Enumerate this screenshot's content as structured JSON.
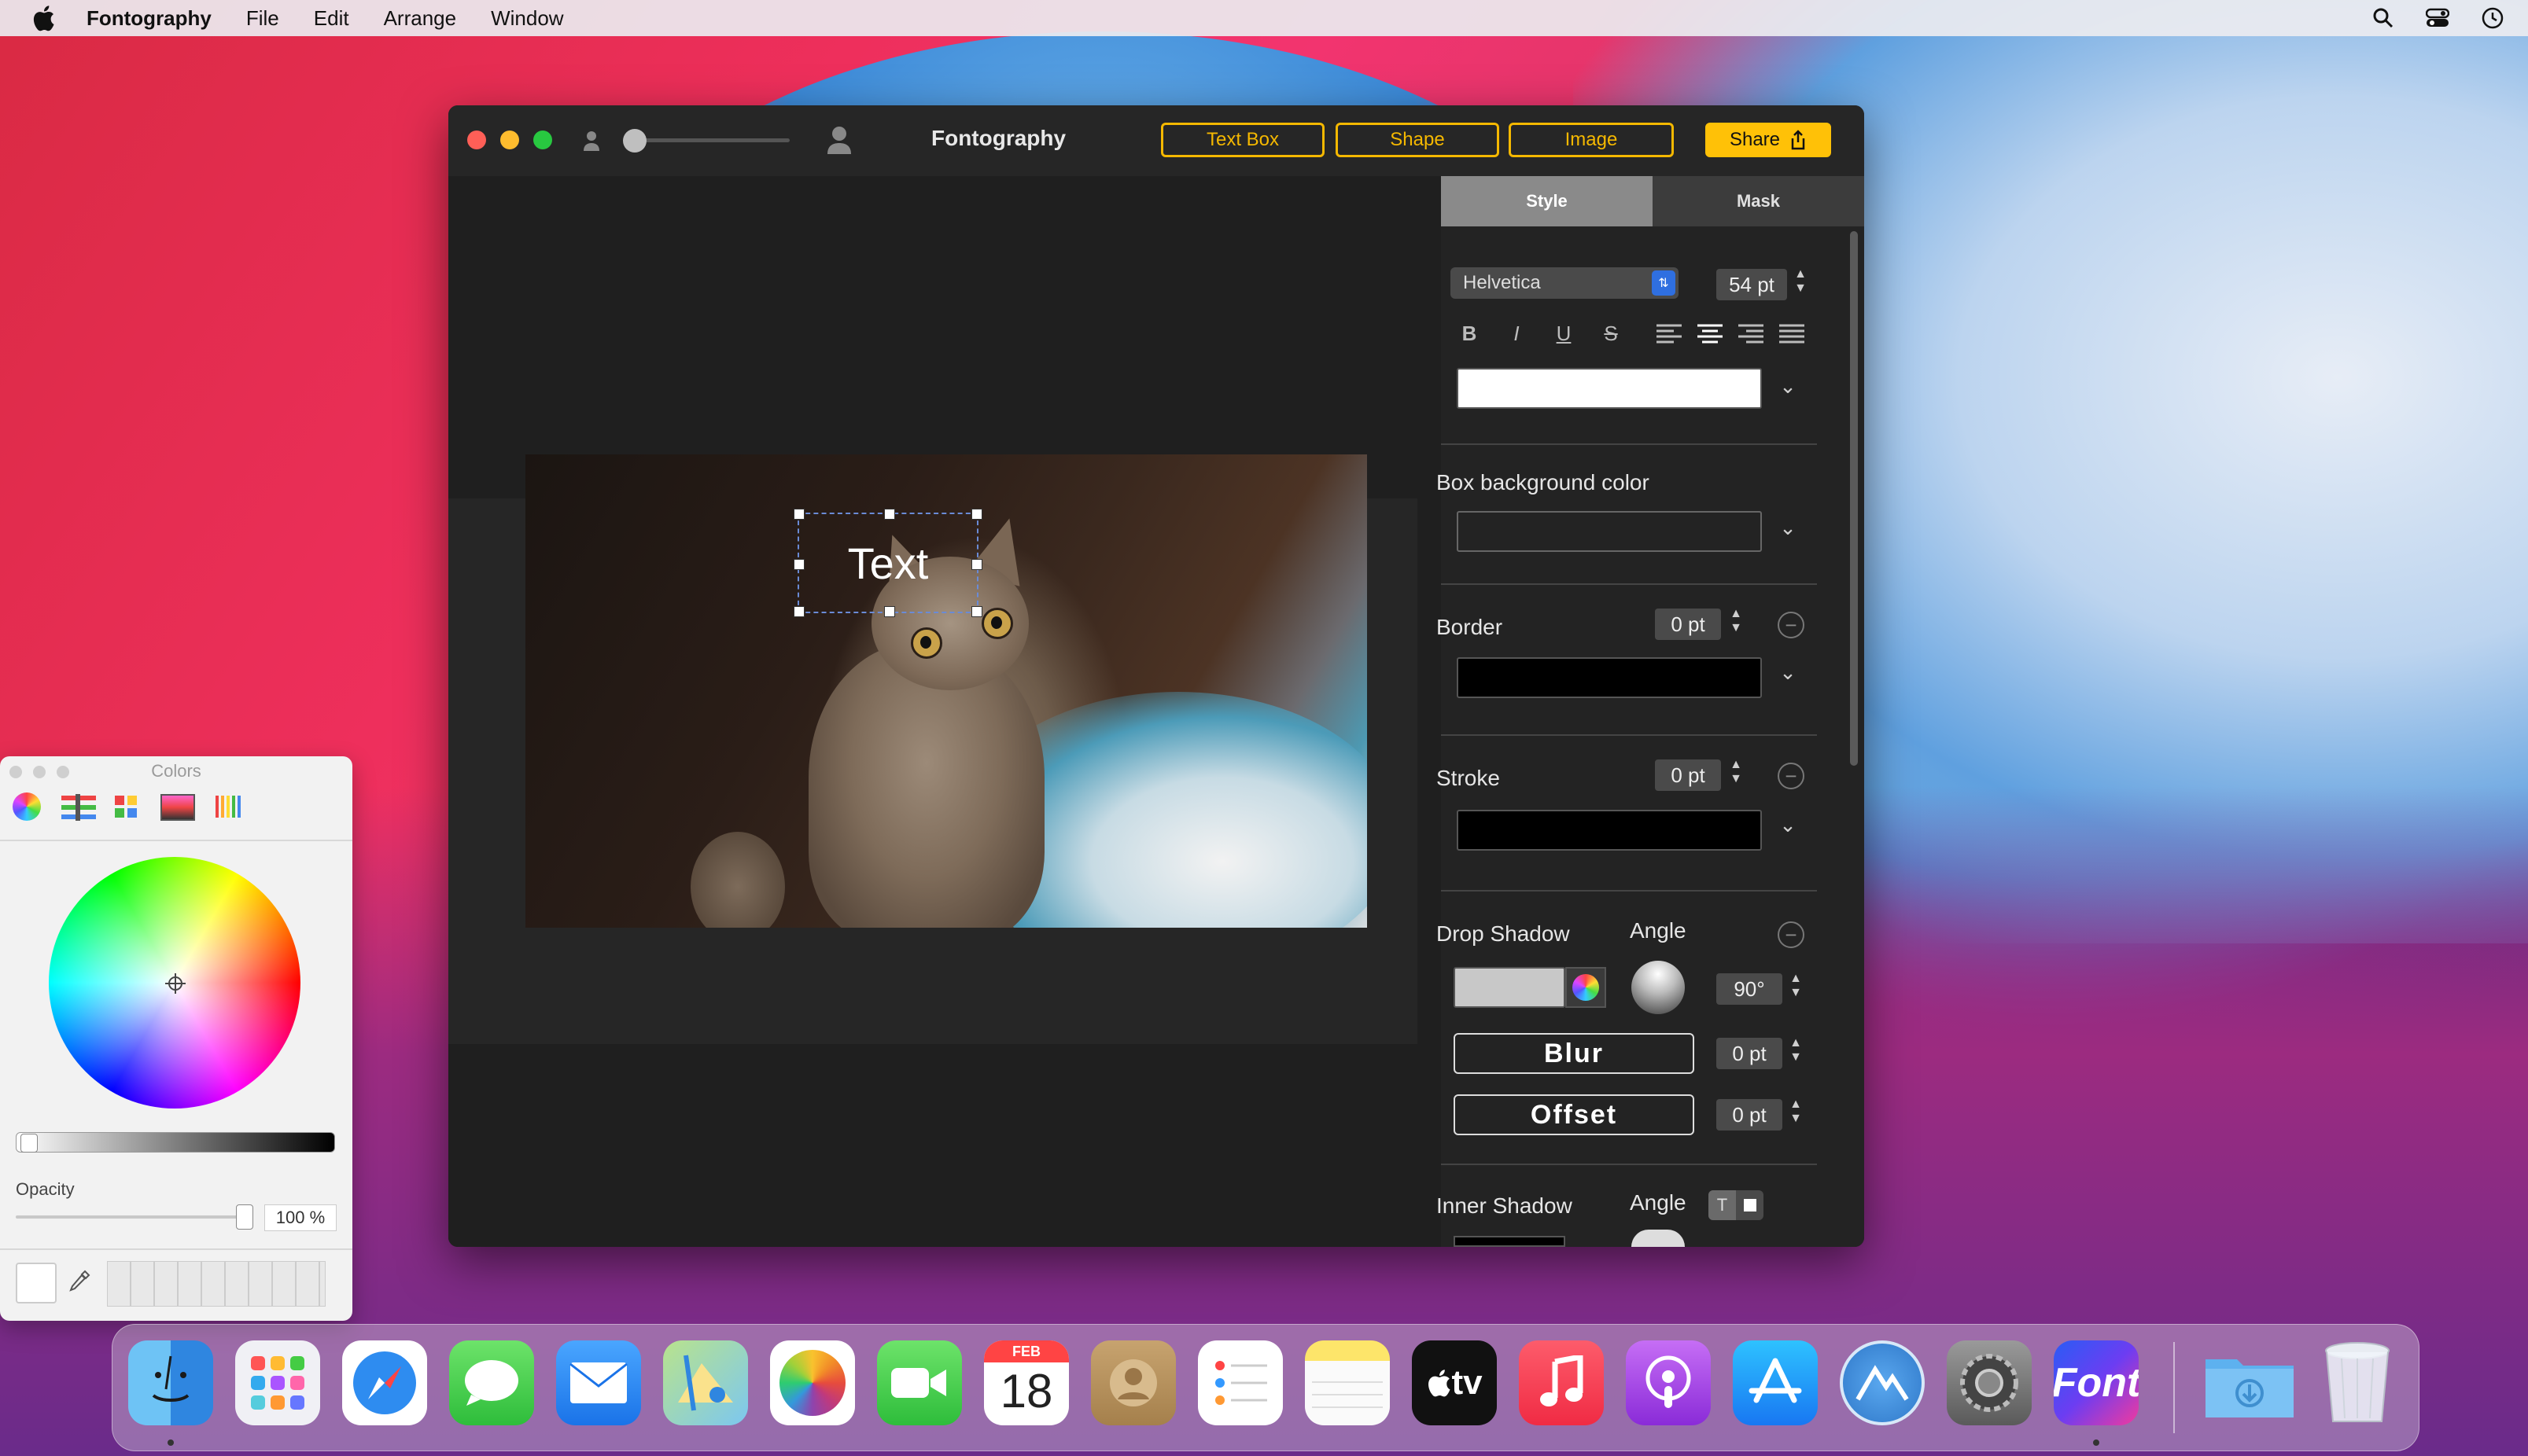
{
  "menubar": {
    "app_name": "Fontography",
    "items": [
      "File",
      "Edit",
      "Arrange",
      "Window"
    ],
    "right_icons": [
      "search-icon",
      "control-center-icon",
      "clock-icon"
    ]
  },
  "window": {
    "title": "Fontography",
    "toolbar": {
      "text_box": "Text Box",
      "shape": "Shape",
      "image": "Image",
      "share": "Share"
    }
  },
  "canvas": {
    "text_layer": "Text"
  },
  "inspector": {
    "tabs": {
      "style": "Style",
      "mask": "Mask"
    },
    "font": {
      "family": "Helvetica",
      "size": "54 pt"
    },
    "format_buttons": [
      "B",
      "I",
      "U",
      "S"
    ],
    "alignment": [
      "align-left-icon",
      "align-center-icon",
      "align-right-icon",
      "align-justify-icon"
    ],
    "text_color": "#ffffff",
    "box_bg": {
      "label": "Box background color",
      "color": "#232323"
    },
    "border": {
      "label": "Border",
      "value": "0 pt",
      "color": "#000000"
    },
    "stroke": {
      "label": "Stroke",
      "value": "0 pt",
      "color": "#000000"
    },
    "drop_shadow": {
      "label": "Drop Shadow",
      "angle_label": "Angle",
      "angle_value": "90°",
      "color": "#c8c8c8",
      "blur_label": "Blur",
      "blur_value": "0 pt",
      "offset_label": "Offset",
      "offset_value": "0 pt"
    },
    "inner_shadow": {
      "label": "Inner Shadow",
      "angle_label": "Angle",
      "toggle": "T"
    }
  },
  "colors_panel": {
    "title": "Colors",
    "opacity_label": "Opacity",
    "opacity_value": "100 %"
  },
  "dock": {
    "calendar_month": "FEB",
    "calendar_day": "18",
    "tv_label": "tv",
    "font_app_label": "Font",
    "apps": [
      "Finder",
      "Launchpad",
      "Safari",
      "Messages",
      "Mail",
      "Maps",
      "Photos",
      "FaceTime",
      "Calendar",
      "Contacts",
      "Reminders",
      "Notes",
      "TV",
      "Music",
      "Podcasts",
      "App Store",
      "Mountain Duck",
      "System Preferences",
      "Fontography",
      "Downloads",
      "Trash"
    ]
  }
}
